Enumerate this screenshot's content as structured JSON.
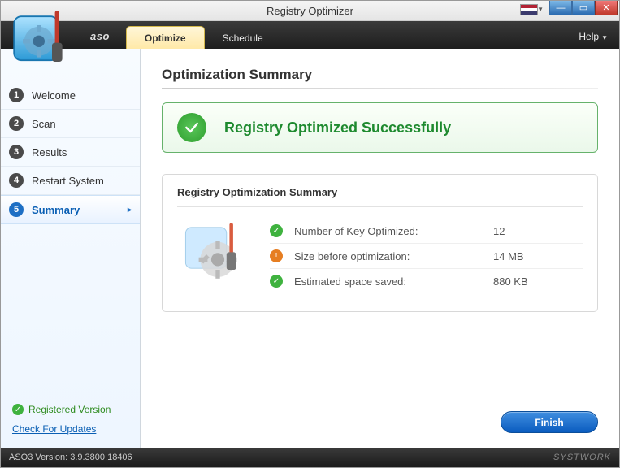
{
  "window": {
    "title": "Registry Optimizer"
  },
  "brand": "aso",
  "tabs": {
    "optimize": "Optimize",
    "schedule": "Schedule"
  },
  "help": "Help",
  "sidebar": {
    "steps": [
      {
        "num": "1",
        "label": "Welcome"
      },
      {
        "num": "2",
        "label": "Scan"
      },
      {
        "num": "3",
        "label": "Results"
      },
      {
        "num": "4",
        "label": "Restart System"
      },
      {
        "num": "5",
        "label": "Summary"
      }
    ],
    "registered": "Registered Version",
    "updates": "Check For Updates"
  },
  "main": {
    "heading": "Optimization Summary",
    "banner": "Registry Optimized Successfully",
    "panel_title": "Registry Optimization Summary",
    "rows": [
      {
        "icon": "ok",
        "label": "Number of Key Optimized:",
        "value": "12"
      },
      {
        "icon": "warn",
        "label": "Size before optimization:",
        "value": "14 MB"
      },
      {
        "icon": "ok",
        "label": "Estimated space saved:",
        "value": "880 KB"
      }
    ],
    "finish": "Finish"
  },
  "status": {
    "version": "ASO3 Version: 3.9.3800.18406",
    "company": "SYSTWORK"
  }
}
